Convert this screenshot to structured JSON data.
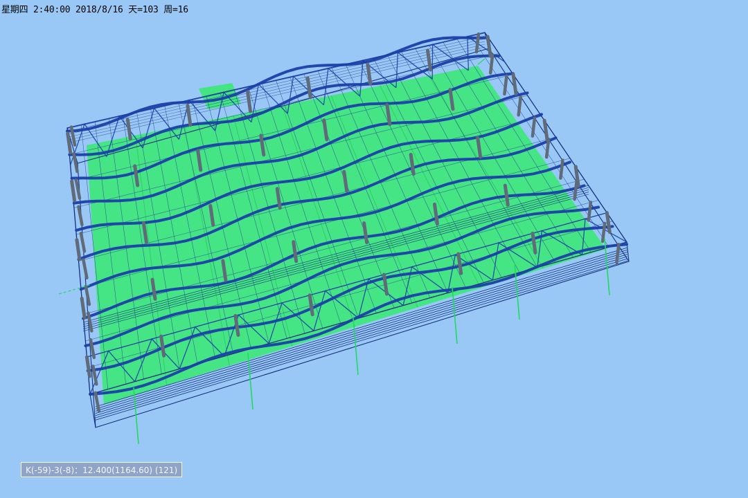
{
  "status": {
    "datetime": "星期四 2:40:00 2018/8/16 天=103 周=16"
  },
  "coord": {
    "readout": "K(-59)-3(-8)：12.400(1164.60) (121)"
  },
  "colors": {
    "background": "#99c8f7",
    "slab": "#3ee67a",
    "frame": "#15307e",
    "beam": "#1b3fa8",
    "column": "#5f6b78",
    "foundation": "#1fdc5c"
  }
}
